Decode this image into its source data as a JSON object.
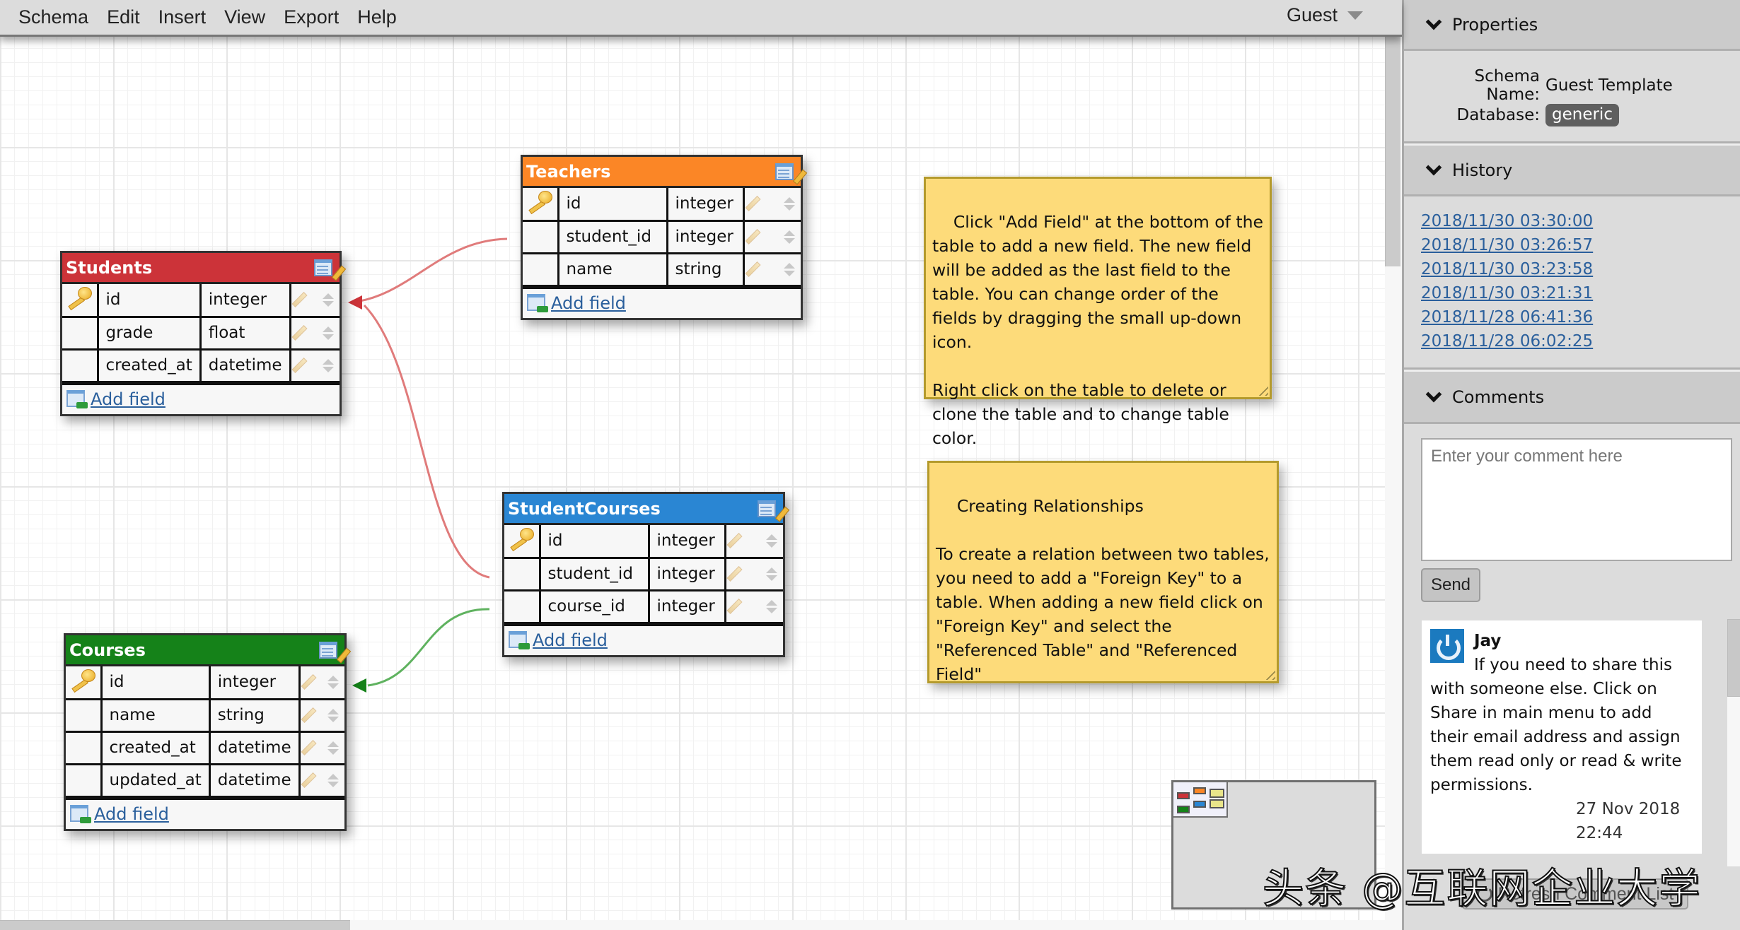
{
  "menubar": {
    "items": [
      "Schema",
      "Edit",
      "Insert",
      "View",
      "Export",
      "Help"
    ],
    "user": "Guest"
  },
  "tables": {
    "students": {
      "title": "Students",
      "color": "#cc3339",
      "fields": [
        {
          "name": "id",
          "type": "integer",
          "primary": true
        },
        {
          "name": "grade",
          "type": "float",
          "primary": false
        },
        {
          "name": "created_at",
          "type": "datetime",
          "primary": false
        }
      ],
      "add_field": "Add field"
    },
    "teachers": {
      "title": "Teachers",
      "color": "#fb8626",
      "fields": [
        {
          "name": "id",
          "type": "integer",
          "primary": true
        },
        {
          "name": "student_id",
          "type": "integer",
          "primary": false
        },
        {
          "name": "name",
          "type": "string",
          "primary": false
        }
      ],
      "add_field": "Add field"
    },
    "studentcourses": {
      "title": "StudentCourses",
      "color": "#2a86d3",
      "fields": [
        {
          "name": "id",
          "type": "integer",
          "primary": true
        },
        {
          "name": "student_id",
          "type": "integer",
          "primary": false
        },
        {
          "name": "course_id",
          "type": "integer",
          "primary": false
        }
      ],
      "add_field": "Add field"
    },
    "courses": {
      "title": "Courses",
      "color": "#158219",
      "fields": [
        {
          "name": "id",
          "type": "integer",
          "primary": true
        },
        {
          "name": "name",
          "type": "string",
          "primary": false
        },
        {
          "name": "created_at",
          "type": "datetime",
          "primary": false
        },
        {
          "name": "updated_at",
          "type": "datetime",
          "primary": false
        }
      ],
      "add_field": "Add field"
    }
  },
  "relations": [
    {
      "from": "Teachers.student_id",
      "to": "Students.id",
      "color": "#d9534f"
    },
    {
      "from": "StudentCourses.student_id",
      "to": "Students.id",
      "color": "#d9534f"
    },
    {
      "from": "StudentCourses.course_id",
      "to": "Courses.id",
      "color": "#3a9a3a"
    }
  ],
  "notes": {
    "note1": "Click \"Add Field\" at the bottom of the table to add a new field. The new field will be added as the last field to the table. You can change order of the fields by dragging the small up-down icon.\n\nRight click on the table to delete or clone the table and to change table color.",
    "note2": "Creating Relationships\n\nTo create a relation between two tables, you need to add a \"Foreign Key\" to a table. When adding a new field click on \"Foreign Key\" and select the \"Referenced Table\" and \"Referenced Field\""
  },
  "panel": {
    "properties": {
      "title": "Properties",
      "schema_name_label": "Schema Name:",
      "schema_name": "Guest Template",
      "database_label": "Database:",
      "database": "generic"
    },
    "history": {
      "title": "History",
      "entries": [
        "2018/11/30 03:30:00",
        "2018/11/30 03:26:57",
        "2018/11/30 03:23:58",
        "2018/11/30 03:21:31",
        "2018/11/28 06:41:36",
        "2018/11/28 06:02:25"
      ]
    },
    "comments": {
      "title": "Comments",
      "placeholder": "Enter your comment here",
      "send": "Send",
      "items": [
        {
          "author": "Jay",
          "text": "If you need to share this with someone else. Click on Share in main menu to add their email address and assign them read only or read & write permissions.",
          "date": "27 Nov 2018 22:44"
        }
      ],
      "refresh": "Refresh Comment List"
    }
  },
  "watermark": "头条 @互联网企业大学"
}
